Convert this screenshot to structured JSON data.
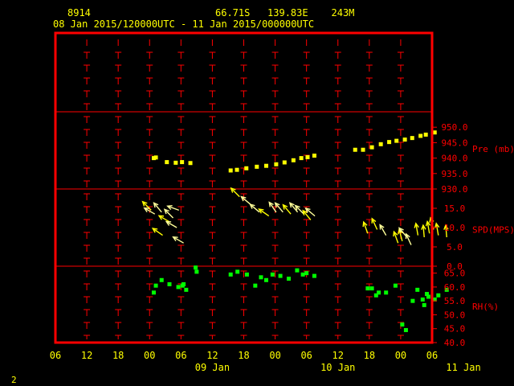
{
  "header": {
    "station_id": "8914",
    "coords": "66.71S   139.83E    243M",
    "time_range": "08 Jan 2015/120000UTC - 11 Jan 2015/000000UTC"
  },
  "page_number": "2",
  "colors": {
    "frame": "#ff0000",
    "pressure": "#ffff00",
    "wind": "#ffff00",
    "wind_light": "#ffff99",
    "rh": "#00ff00",
    "text": "#ffff00",
    "axis_text": "#ff0000"
  },
  "chart_data": {
    "type": "scatter",
    "x_axis": {
      "tick_labels": [
        "06",
        "12",
        "18",
        "00",
        "06",
        "12",
        "18",
        "00",
        "06",
        "12",
        "18",
        "00",
        "06"
      ],
      "date_labels": [
        {
          "label": "09 Jan",
          "at_hour": 24
        },
        {
          "label": "10 Jan",
          "at_hour": 48
        },
        {
          "label": "11 Jan",
          "at_hour": 72
        }
      ],
      "range_hours": [
        -6,
        66
      ],
      "start": "08 Jan 2015 06 UTC"
    },
    "panels": [
      {
        "key": "pressure",
        "label": "Pre (mb)",
        "unit": "mb",
        "ylim": [
          930,
          955
        ],
        "ticks": [
          930.0,
          935.0,
          940.0,
          945.0,
          950.0
        ],
        "points": [
          [
            12.8,
            940.0
          ],
          [
            13.2,
            940.2
          ],
          [
            15.3,
            938.7
          ],
          [
            17.0,
            938.5
          ],
          [
            18.2,
            938.7
          ],
          [
            19.8,
            938.4
          ],
          [
            27.5,
            936.0
          ],
          [
            28.7,
            936.2
          ],
          [
            30.5,
            936.7
          ],
          [
            32.5,
            937.2
          ],
          [
            34.3,
            937.5
          ],
          [
            36.2,
            938.0
          ],
          [
            37.8,
            938.6
          ],
          [
            39.5,
            939.3
          ],
          [
            41.0,
            940.0
          ],
          [
            42.2,
            940.3
          ],
          [
            43.5,
            940.8
          ],
          [
            51.3,
            942.7
          ],
          [
            52.8,
            942.7
          ],
          [
            54.5,
            943.5
          ],
          [
            56.2,
            944.5
          ],
          [
            57.8,
            945.2
          ],
          [
            59.2,
            945.6
          ],
          [
            60.8,
            946.0
          ],
          [
            62.2,
            946.5
          ],
          [
            63.8,
            947.2
          ],
          [
            64.8,
            947.6
          ],
          [
            66.5,
            948.3
          ]
        ]
      },
      {
        "key": "wind",
        "label": "SPD(MPS)",
        "unit": "m/s",
        "ylim": [
          0,
          20
        ],
        "ticks": [
          0.0,
          5.0,
          10.0,
          15.0
        ],
        "points": [
          {
            "x": 12.3,
            "speed": 14.5,
            "dir_deg": 315
          },
          {
            "x": 13.0,
            "speed": 13.5,
            "dir_deg": 300
          },
          {
            "x": 14.3,
            "speed": 14.0,
            "dir_deg": 320
          },
          {
            "x": 15.8,
            "speed": 11.5,
            "dir_deg": 300
          },
          {
            "x": 16.5,
            "speed": 12.5,
            "dir_deg": 315
          },
          {
            "x": 17.2,
            "speed": 10.0,
            "dir_deg": 300
          },
          {
            "x": 14.5,
            "speed": 8.0,
            "dir_deg": 305
          },
          {
            "x": 18.5,
            "speed": 6.0,
            "dir_deg": 300
          },
          {
            "x": 17.6,
            "speed": 14.5,
            "dir_deg": 290
          },
          {
            "x": 29.2,
            "speed": 18.0,
            "dir_deg": 315
          },
          {
            "x": 31.3,
            "speed": 16.0,
            "dir_deg": 310
          },
          {
            "x": 33.0,
            "speed": 14.0,
            "dir_deg": 310
          },
          {
            "x": 34.8,
            "speed": 13.0,
            "dir_deg": 305
          },
          {
            "x": 36.2,
            "speed": 14.0,
            "dir_deg": 325
          },
          {
            "x": 37.5,
            "speed": 14.0,
            "dir_deg": 320
          },
          {
            "x": 39.0,
            "speed": 13.5,
            "dir_deg": 320
          },
          {
            "x": 40.3,
            "speed": 14.0,
            "dir_deg": 320
          },
          {
            "x": 41.5,
            "speed": 13.5,
            "dir_deg": 315
          },
          {
            "x": 42.8,
            "speed": 12.0,
            "dir_deg": 320
          },
          {
            "x": 43.6,
            "speed": 13.0,
            "dir_deg": 310
          },
          {
            "x": 53.7,
            "speed": 8.5,
            "dir_deg": 340
          },
          {
            "x": 55.5,
            "speed": 9.5,
            "dir_deg": 335
          },
          {
            "x": 57.2,
            "speed": 8.0,
            "dir_deg": 330
          },
          {
            "x": 59.5,
            "speed": 6.0,
            "dir_deg": 340
          },
          {
            "x": 60.3,
            "speed": 6.5,
            "dir_deg": 345
          },
          {
            "x": 61.2,
            "speed": 7.5,
            "dir_deg": 320
          },
          {
            "x": 62.0,
            "speed": 5.5,
            "dir_deg": 335
          },
          {
            "x": 63.3,
            "speed": 8.0,
            "dir_deg": 350
          },
          {
            "x": 64.5,
            "speed": 7.5,
            "dir_deg": 355
          },
          {
            "x": 65.5,
            "speed": 8.5,
            "dir_deg": 350
          },
          {
            "x": 66.3,
            "speed": 9.5,
            "dir_deg": 345
          },
          {
            "x": 67.2,
            "speed": 8.0,
            "dir_deg": 350
          },
          {
            "x": 68.8,
            "speed": 7.5,
            "dir_deg": 355
          }
        ]
      },
      {
        "key": "rh",
        "label": "RH(%)",
        "unit": "%",
        "ylim": [
          40,
          67.5
        ],
        "ticks": [
          40.0,
          45.0,
          50.0,
          55.0,
          60.0,
          65.0
        ],
        "points": [
          [
            12.8,
            58.0
          ],
          [
            13.2,
            60.5
          ],
          [
            14.3,
            62.5
          ],
          [
            15.8,
            61.0
          ],
          [
            17.5,
            60.0
          ],
          [
            18.3,
            60.5
          ],
          [
            19.0,
            59.0
          ],
          [
            18.5,
            61.0
          ],
          [
            21.0,
            65.5
          ],
          [
            20.8,
            67.0
          ],
          [
            27.5,
            64.5
          ],
          [
            28.8,
            65.5
          ],
          [
            30.6,
            64.5
          ],
          [
            32.2,
            60.5
          ],
          [
            33.3,
            63.5
          ],
          [
            34.3,
            62.5
          ],
          [
            35.5,
            64.5
          ],
          [
            37.0,
            64.0
          ],
          [
            38.6,
            63.0
          ],
          [
            40.2,
            66.0
          ],
          [
            41.3,
            64.5
          ],
          [
            42.0,
            65.0
          ],
          [
            43.5,
            64.0
          ],
          [
            53.7,
            59.5
          ],
          [
            54.5,
            59.5
          ],
          [
            55.3,
            57.0
          ],
          [
            55.8,
            58.0
          ],
          [
            57.2,
            58.0
          ],
          [
            59.0,
            60.5
          ],
          [
            60.3,
            46.5
          ],
          [
            61.0,
            44.5
          ],
          [
            62.3,
            55.0
          ],
          [
            63.2,
            59.0
          ],
          [
            64.2,
            55.5
          ],
          [
            64.5,
            53.5
          ],
          [
            65.0,
            57.5
          ],
          [
            65.3,
            56.5
          ],
          [
            66.5,
            55.5
          ],
          [
            67.2,
            57.0
          ],
          [
            68.8,
            59.0
          ]
        ]
      }
    ]
  }
}
